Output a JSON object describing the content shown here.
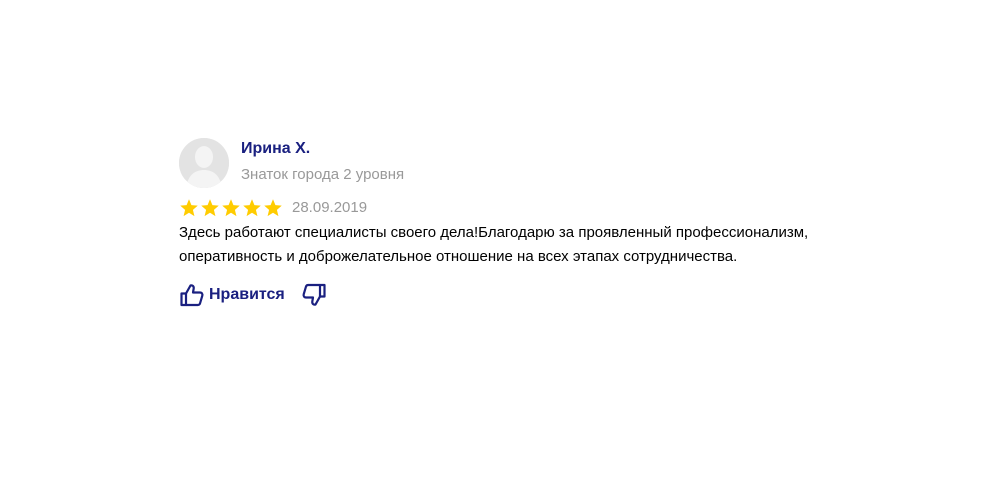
{
  "review": {
    "author": {
      "name": "Ирина Х.",
      "level": "Знаток города 2 уровня",
      "avatar_icon": "default-user-avatar-icon"
    },
    "rating": {
      "value": 5,
      "max": 5,
      "star_color": "#ffcc00",
      "star_icon": "star-icon"
    },
    "date": "28.09.2019",
    "text": "Здесь работают специалисты своего дела!Благодарю за проявленный профессионализм, оперативность и доброжелательное отношение на всех этапах сотрудничества.",
    "actions": {
      "like_label": "Нравится",
      "like_icon": "thumbs-up-icon",
      "dislike_icon": "thumbs-down-icon",
      "accent_color": "#1a2080"
    }
  }
}
